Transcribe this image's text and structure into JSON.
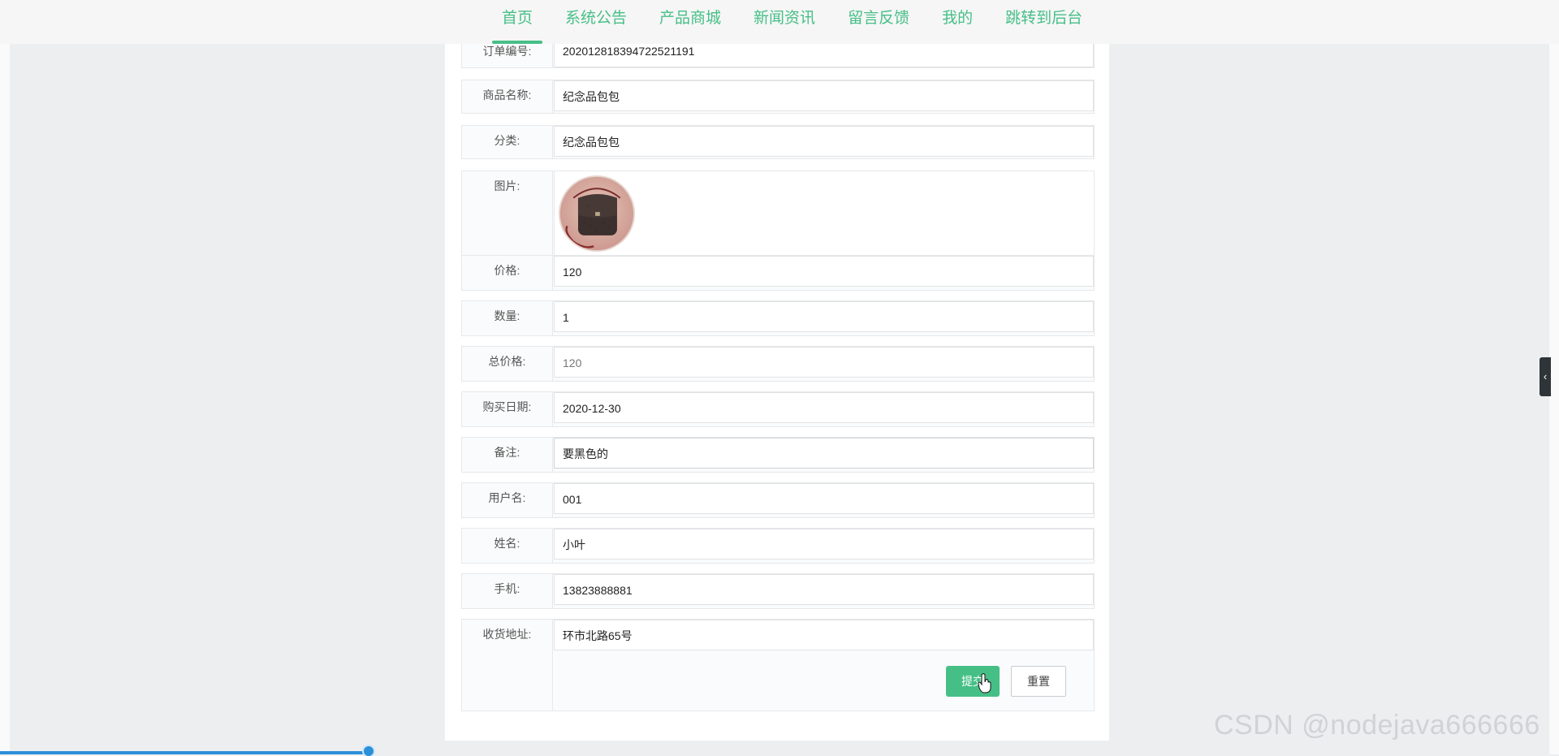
{
  "nav": {
    "items": [
      "首页",
      "系统公告",
      "产品商城",
      "新闻资讯",
      "留言反馈",
      "我的",
      "跳转到后台"
    ],
    "active_index": 0
  },
  "form": {
    "order_no": {
      "label": "订单编号:",
      "value": "202012818394722521191"
    },
    "product_name": {
      "label": "商品名称:",
      "value": "纪念品包包"
    },
    "category": {
      "label": "分类:",
      "value": "纪念品包包"
    },
    "picture": {
      "label": "图片:",
      "image": "brown-handbag-photo"
    },
    "price": {
      "label": "价格:",
      "value": "120"
    },
    "quantity": {
      "label": "数量:",
      "value": "1"
    },
    "total": {
      "label": "总价格:",
      "value": "120"
    },
    "purchase_date": {
      "label": "购买日期:",
      "value": "2020-12-30"
    },
    "remark": {
      "label": "备注:",
      "value": "要黑色的"
    },
    "username": {
      "label": "用户名:",
      "value": "001"
    },
    "name": {
      "label": "姓名:",
      "value": "小叶"
    },
    "phone": {
      "label": "手机:",
      "value": "13823888881"
    },
    "address": {
      "label": "收货地址:",
      "value": "环市北路65号"
    }
  },
  "buttons": {
    "submit": "提交",
    "reset": "重置"
  },
  "side_toggle": {
    "icon": "chevron-left-icon",
    "glyph": "‹"
  },
  "watermark": "CSDN @nodejava666666",
  "colors": {
    "accent": "#46bf87",
    "scroll": "#2b8fd9"
  },
  "scroll_progress": 0.24
}
